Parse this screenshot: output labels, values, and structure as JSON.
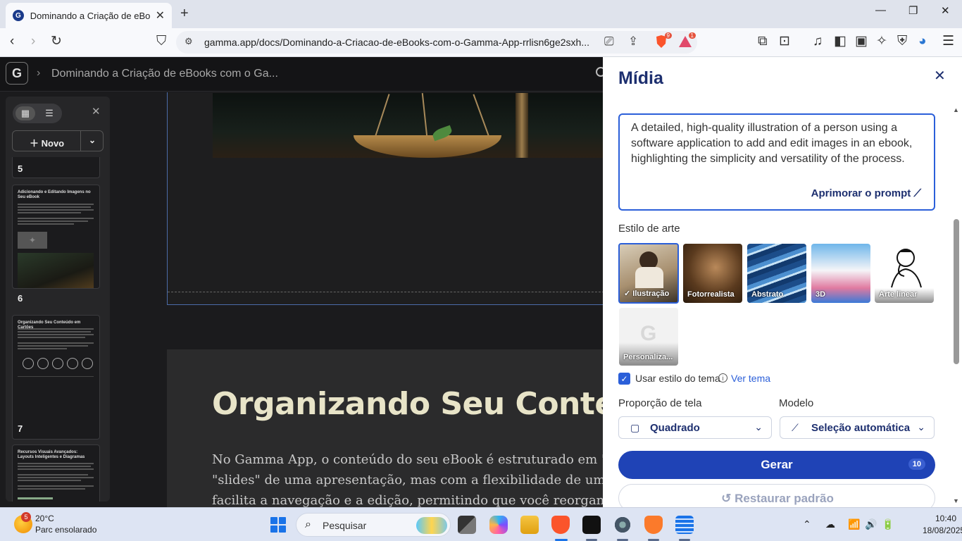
{
  "browser": {
    "tab_title": "Dominando a Criação de eBooks",
    "url": "gamma.app/docs/Dominando-a-Criacao-de-eBooks-com-o-Gamma-App-rrlisn6ge2sxh...",
    "shield_badge": "9",
    "rewards_badge": "1"
  },
  "app": {
    "logo_letter": "G",
    "breadcrumb": "Dominando a Criação de eBooks com o Ga..."
  },
  "sidebar": {
    "new_label": "Novo",
    "slides": [
      {
        "number": "5"
      },
      {
        "number": "6",
        "title": "Adicionando e Editando Imagens no Seu eBook"
      },
      {
        "number": "7",
        "title": "Organizando Seu Conteúdo em Cartões"
      },
      {
        "title": "Recursos Visuais Avançados: Layouts Inteligentes e Diagramas"
      }
    ]
  },
  "canvas": {
    "heading": "Organizando Seu Conteúdo",
    "paragraph": "No Gamma App, o conteúdo do seu eBook é estruturado em \"cartõ \"slides\" de uma apresentação, mas com a flexibilidade de um doc facilita a navegação e a edição, permitindo que você reorganiz"
  },
  "panel": {
    "title": "Mídia",
    "prompt": "A detailed, high-quality illustration of a person using a software application to add and edit images in an ebook, highlighting the simplicity and versatility of the process.",
    "enhance_label": "Aprimorar o prompt",
    "art_style_label": "Estilo de arte",
    "styles": [
      {
        "label": "Ilustração",
        "selected": true
      },
      {
        "label": "Fotorrealista"
      },
      {
        "label": "Abstrato"
      },
      {
        "label": "3D"
      },
      {
        "label": "Arte linear"
      },
      {
        "label": "Personaliza..."
      }
    ],
    "custom_style_letter": "G",
    "use_theme_label": "Usar estilo do tema",
    "view_theme_link": "Ver tema",
    "aspect_label": "Proporção de tela",
    "aspect_value": "Quadrado",
    "model_label": "Modelo",
    "model_value": "Seleção automática",
    "generate_label": "Gerar",
    "generate_credits": "10",
    "reset_label": "Restaurar padrão"
  },
  "taskbar": {
    "weather_badge": "5",
    "temperature": "20°C",
    "condition": "Parc ensolarado",
    "search_placeholder": "Pesquisar",
    "time": "10:40",
    "date": "18/08/2025"
  },
  "colors": {
    "accent": "#1f43b6",
    "title_blue": "#1d2f6f",
    "app_bg": "#1b1b1d"
  }
}
